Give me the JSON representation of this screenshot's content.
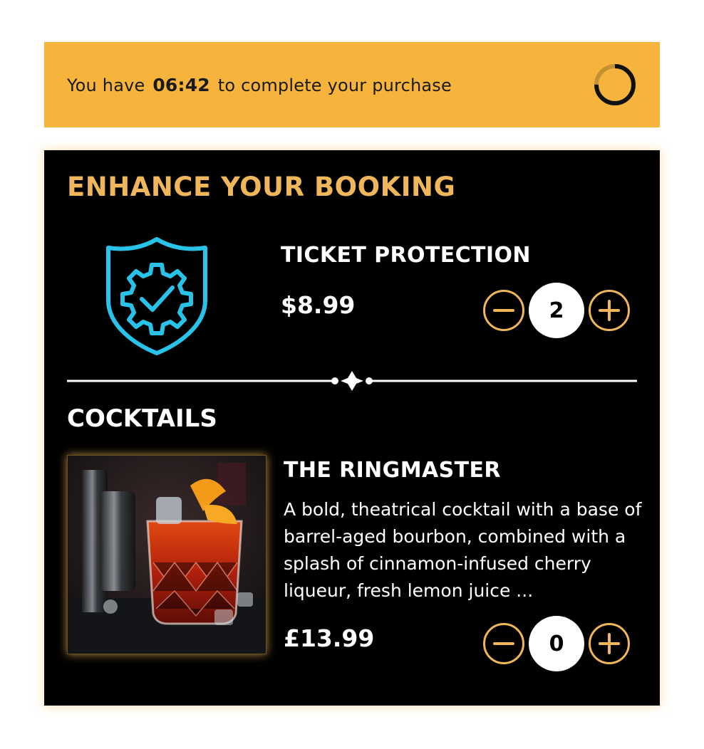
{
  "timer": {
    "prefix": "You have",
    "time": "06:42",
    "suffix": "to complete your purchase",
    "icon": "countdown-ring-icon",
    "progress": 0.75
  },
  "section": {
    "heading": "ENHANCE YOUR BOOKING"
  },
  "ticket_protection": {
    "icon": "shield-gear-check-icon",
    "title": "TICKET PROTECTION",
    "price": "$8.99",
    "quantity": "2"
  },
  "cocktails": {
    "heading": "COCKTAILS",
    "item": {
      "image": "cocktail-photo",
      "title": "THE RINGMASTER",
      "description": "A bold, theatrical cocktail with a base of barrel-aged bourbon, combined with a splash of cinnamon-infused cherry liqueur, fresh lemon juice ...",
      "price": "£13.99",
      "quantity": "0"
    }
  },
  "colors": {
    "banner": "#f6b43c",
    "accent": "#f0b75a",
    "shield": "#29c3ea",
    "card_bg": "#000000"
  }
}
